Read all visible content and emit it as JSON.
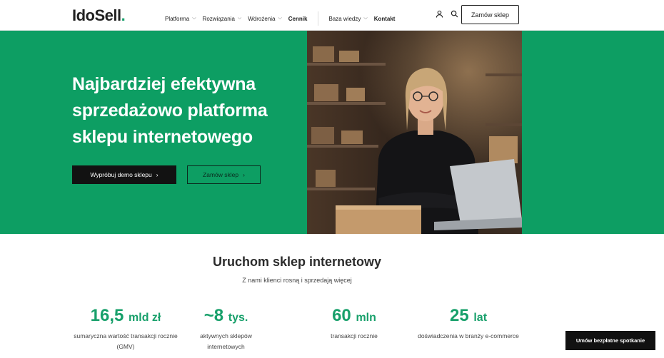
{
  "brand": {
    "logo_main": "IdoSell",
    "logo_dot": ".",
    "accent": "#18a06b",
    "hero_bg": "#0d9e63"
  },
  "nav": {
    "items": [
      {
        "label": "Platforma",
        "dropdown": true
      },
      {
        "label": "Rozwiązania",
        "dropdown": true
      },
      {
        "label": "Wdrożenia",
        "dropdown": true
      },
      {
        "label": "Cennik",
        "dropdown": false
      }
    ],
    "items2": [
      {
        "label": "Baza wiedzy",
        "dropdown": true
      },
      {
        "label": "Kontakt",
        "dropdown": false
      }
    ],
    "icons": [
      "user-icon",
      "search-icon"
    ],
    "cta": "Zamów sklep"
  },
  "hero": {
    "title": "Najbardziej efektywna sprzedażowo platforma sklepu internetowego",
    "btn_demo": "Wypróbuj demo sklepu",
    "btn_order": "Zamów sklep"
  },
  "stats_section": {
    "title": "Uruchom sklep internetowy",
    "subtitle": "Z nami klienci rosną i sprzedają więcej",
    "stats": [
      {
        "value": "16,5",
        "unit": "mld zł",
        "label": "sumaryczna wartość transakcji rocznie (GMV)"
      },
      {
        "value": "~8",
        "unit": "tys.",
        "label": "aktywnych sklepów internetowych"
      },
      {
        "value": "60",
        "unit": "mln",
        "label": "transakcji rocznie"
      },
      {
        "value": "25",
        "unit": "lat",
        "label": "doświadczenia w branży e-commerce"
      }
    ]
  },
  "float_cta": "Umów bezpłatne spotkanie"
}
